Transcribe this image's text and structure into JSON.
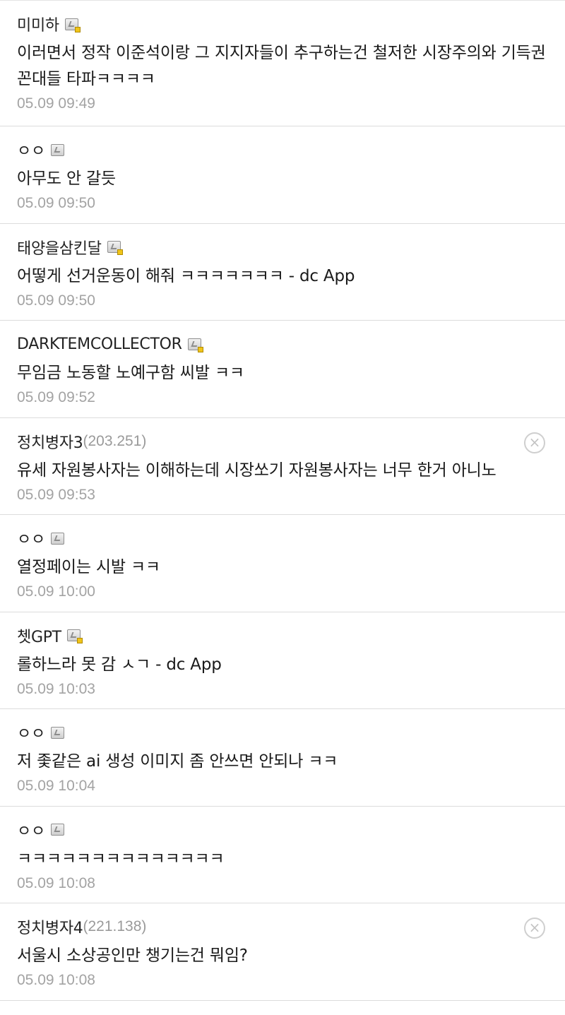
{
  "comments": [
    {
      "nick": "미미하",
      "ip": "",
      "badge": "gold",
      "text": "이러면서 정작 이준석이랑 그 지지자들이 추구하는건 철저한 시장주의와 기득권 꼰대들 타파ㅋㅋㅋㅋ",
      "date": "05.09 09:49",
      "deletable": false
    },
    {
      "nick": "ㅇㅇ",
      "ip": "",
      "badge": "plain",
      "text": "아무도 안 갈듯",
      "date": "05.09 09:50",
      "deletable": false
    },
    {
      "nick": "태양을삼킨달",
      "ip": "",
      "badge": "gold",
      "text": "어떻게 선거운동이 해줘 ㅋㅋㅋㅋㅋㅋㅋ - dc App",
      "date": "05.09 09:50",
      "deletable": false
    },
    {
      "nick": "DARKTEMCOLLECTOR",
      "ip": "",
      "badge": "gold",
      "text": "무임금 노동할 노예구함 씨발 ㅋㅋ",
      "date": "05.09 09:52",
      "deletable": false
    },
    {
      "nick": "정치병자3",
      "ip": "(203.251)",
      "badge": "none",
      "text": "유세 자원봉사자는 이해하는데 시장쏘기 자원봉사자는 너무 한거 아니노",
      "date": "05.09 09:53",
      "deletable": true
    },
    {
      "nick": "ㅇㅇ",
      "ip": "",
      "badge": "plain",
      "text": "열정페이는 시발 ㅋㅋ",
      "date": "05.09 10:00",
      "deletable": false
    },
    {
      "nick": "쳇GPT",
      "ip": "",
      "badge": "gold",
      "text": "롤하느라 못 감 ㅅㄱ - dc App",
      "date": "05.09 10:03",
      "deletable": false
    },
    {
      "nick": "ㅇㅇ",
      "ip": "",
      "badge": "plain",
      "text": "저 좇같은 ai 생성 이미지 좀 안쓰면 안되나 ㅋㅋ",
      "date": "05.09 10:04",
      "deletable": false
    },
    {
      "nick": "ㅇㅇ",
      "ip": "",
      "badge": "plain",
      "text": "ㅋㅋㅋㅋㅋㅋㅋㅋㅋㅋㅋㅋㅋㅋ",
      "date": "05.09 10:08",
      "deletable": false
    },
    {
      "nick": "정치병자4",
      "ip": "(221.138)",
      "badge": "none",
      "text": "서울시 소상공인만 챙기는건 뭐임?",
      "date": "05.09 10:08",
      "deletable": true
    }
  ],
  "delete_glyph": "×"
}
